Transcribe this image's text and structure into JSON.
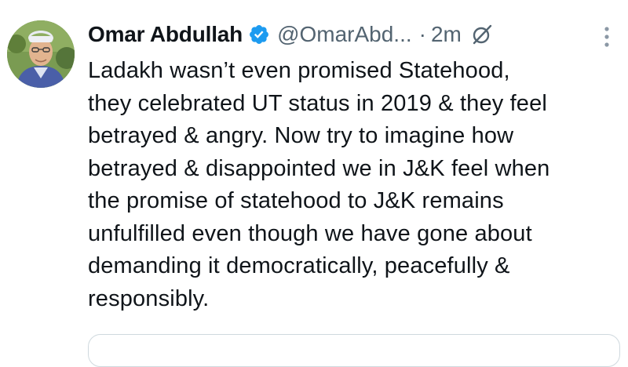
{
  "author": {
    "name": "Omar Abdullah",
    "handle": "@OmarAbd...",
    "verified": true,
    "avatar_icon": "profile-photo"
  },
  "meta": {
    "separator": "·",
    "timestamp": "2m",
    "grok_icon": "grok-icon",
    "more_icon": "more-options-icon"
  },
  "tweet": {
    "text": "Ladakh wasn’t even promised Statehood,\nthey celebrated UT status in 2019 & they feel\nbetrayed & angry. Now try to imagine how\nbetrayed & disappointed we in J&K feel when\nthe promise of statehood to J&K remains\nunfulfilled even though we have gone about\ndemanding it democratically, peacefully &\nresponsibly."
  },
  "colors": {
    "text": "#0f1419",
    "secondary": "#536471",
    "verified": "#1d9bf0",
    "border": "#cfd9de"
  }
}
